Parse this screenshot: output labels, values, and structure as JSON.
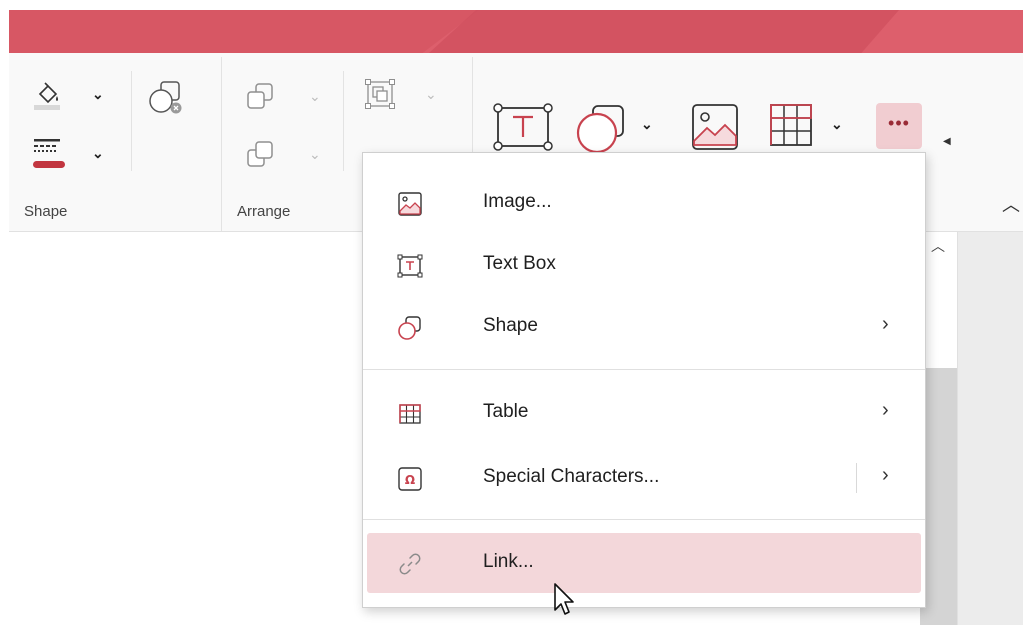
{
  "ribbon": {
    "groups": {
      "shape": {
        "label": "Shape"
      },
      "arrange": {
        "label": "Arrange"
      }
    },
    "more_button_label": "•••"
  },
  "insert_menu": {
    "items": [
      {
        "label": "Image...",
        "icon": "image-icon",
        "has_submenu": false
      },
      {
        "label": "Text Box",
        "icon": "text-box-icon",
        "has_submenu": false
      },
      {
        "label": "Shape",
        "icon": "shape-icon",
        "has_submenu": true
      },
      {
        "label": "Table",
        "icon": "table-icon",
        "has_submenu": true
      },
      {
        "label": "Special Characters...",
        "icon": "omega-icon",
        "has_submenu": true
      },
      {
        "label": "Link...",
        "icon": "link-icon",
        "has_submenu": false,
        "hovered": true
      }
    ],
    "submenu_glyph": "›"
  },
  "colors": {
    "accent": "#c8434f",
    "titlebar": "#dd5f6c",
    "hover": "#f3d7da"
  }
}
